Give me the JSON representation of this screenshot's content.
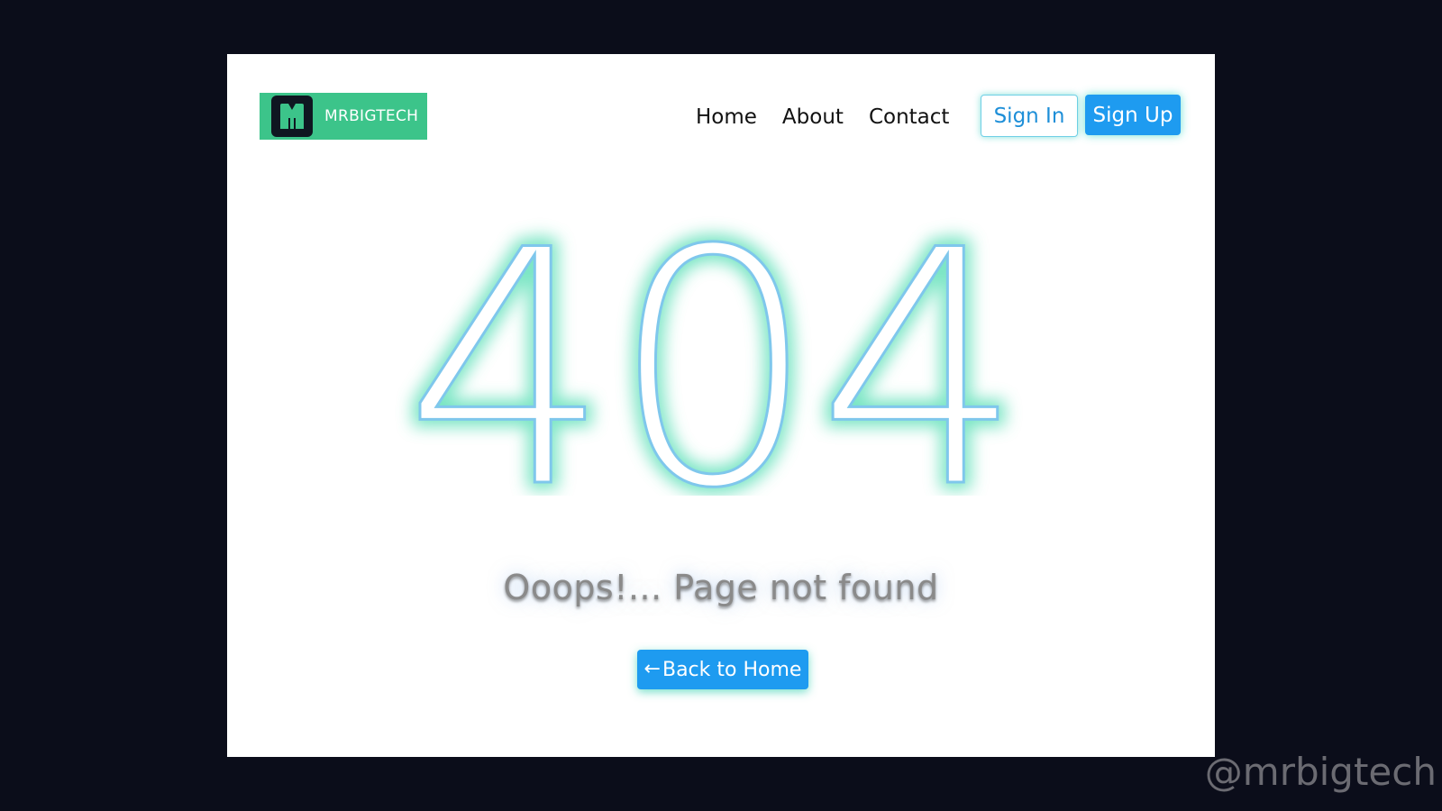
{
  "logo": {
    "text": "MRBIGTECH",
    "icon": "m-logo-icon",
    "background": "#3cc48a"
  },
  "nav": {
    "links": [
      "Home",
      "About",
      "Contact"
    ]
  },
  "auth": {
    "sign_in_label": "Sign In",
    "sign_up_label": "Sign Up"
  },
  "error": {
    "code": "404",
    "message": "Ooops!... Page not found",
    "back_icon": "arrow-left-icon",
    "back_label": "Back to Home"
  },
  "watermark": "@mrbigtech",
  "colors": {
    "accent_blue": "#1e9bf0",
    "accent_green": "#3cc48a",
    "page_background": "#0b0d1a",
    "glow": "#5fe0b8"
  }
}
